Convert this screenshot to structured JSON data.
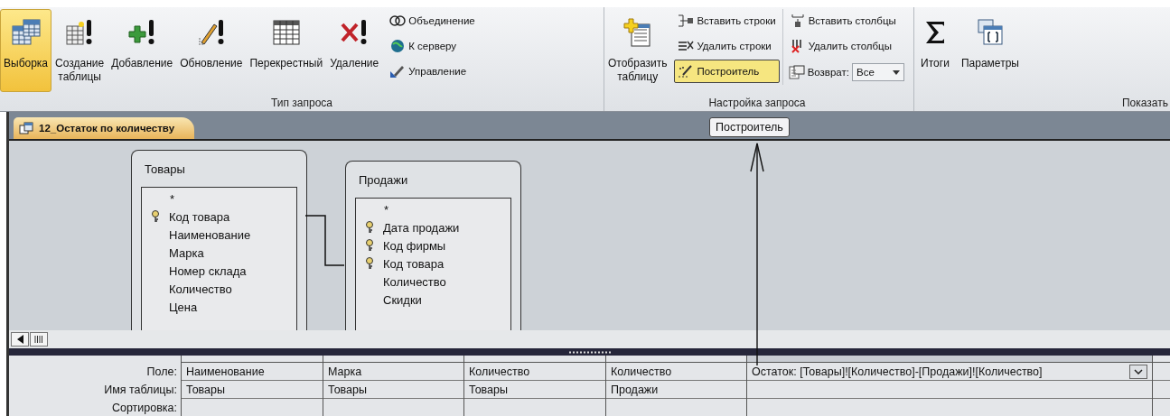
{
  "ribbon": {
    "groups": [
      {
        "label": "Тип запроса",
        "buttons": [
          {
            "kind": "select",
            "label": "Выборка",
            "selected": true
          },
          {
            "kind": "maketable",
            "label": "Создание таблицы",
            "selected": false
          },
          {
            "kind": "append",
            "label": "Добавление",
            "selected": false
          },
          {
            "kind": "update",
            "label": "Обновление",
            "selected": false
          },
          {
            "kind": "crosstab",
            "label": "Перекрестный",
            "selected": false
          },
          {
            "kind": "delete",
            "label": "Удаление",
            "selected": false
          }
        ],
        "columns": [
          [
            {
              "kind": "union",
              "label": "Объединение",
              "selected": false
            },
            {
              "kind": "server",
              "label": "К серверу",
              "selected": false
            },
            {
              "kind": "manage",
              "label": "Управление",
              "selected": false
            }
          ]
        ]
      },
      {
        "label": "Настройка запроса",
        "buttons": [
          {
            "kind": "showtable",
            "label": "Отобразить таблицу",
            "selected": false
          }
        ],
        "columns": [
          [
            {
              "kind": "insrows",
              "label": "Вставить строки",
              "selected": false
            },
            {
              "kind": "delrows",
              "label": "Удалить строки",
              "selected": false
            },
            {
              "kind": "builder",
              "label": "Построитель",
              "selected": true
            }
          ],
          [
            {
              "kind": "inscols",
              "label": "Вставить столбцы",
              "selected": false
            },
            {
              "kind": "delcols",
              "label": "Удалить столбцы",
              "selected": false
            },
            {
              "kind": "return",
              "label": "Возврат:",
              "value": "Все"
            }
          ]
        ]
      },
      {
        "label": "Показать",
        "buttons": [
          {
            "kind": "totals",
            "label": "Итоги",
            "selected": false
          },
          {
            "kind": "params",
            "label": "Параметры",
            "selected": false
          }
        ]
      }
    ]
  },
  "document_tab": {
    "label": "12_Остаток по количеству",
    "selected": true
  },
  "tooltip": {
    "text": "Построитель"
  },
  "tables": [
    {
      "title": "Товары",
      "fields": [
        {
          "name": "*",
          "key": false
        },
        {
          "name": "Код товара",
          "key": true
        },
        {
          "name": "Наименование",
          "key": false
        },
        {
          "name": "Марка",
          "key": false
        },
        {
          "name": "Номер склада",
          "key": false
        },
        {
          "name": "Количество",
          "key": false
        },
        {
          "name": "Цена",
          "key": false
        }
      ]
    },
    {
      "title": "Продажи",
      "fields": [
        {
          "name": "*",
          "key": false
        },
        {
          "name": "Дата продажи",
          "key": true
        },
        {
          "name": "Код фирмы",
          "key": true
        },
        {
          "name": "Код товара",
          "key": true
        },
        {
          "name": "Количество",
          "key": false
        },
        {
          "name": "Скидки",
          "key": false
        }
      ]
    }
  ],
  "grid": {
    "row_labels": [
      "Поле:",
      "Имя таблицы:",
      "Сортировка:"
    ],
    "columns": [
      {
        "field": "Наименование",
        "table": "Товары",
        "focused": false
      },
      {
        "field": "Марка",
        "table": "Товары",
        "focused": false
      },
      {
        "field": "Количество",
        "table": "Товары",
        "focused": false
      },
      {
        "field": "Количество",
        "table": "Продажи",
        "focused": false
      },
      {
        "field": "Остаток: [Товары]![Количество]-[Продажи]![Количество]",
        "focused": true
      }
    ]
  }
}
